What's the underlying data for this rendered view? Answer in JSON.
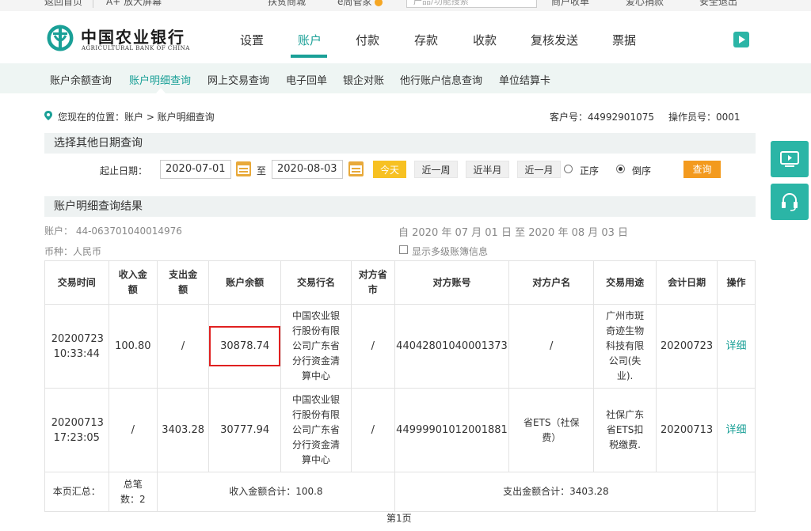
{
  "topbar": {
    "back_home": "返回首页",
    "enlarge": "A+ 放大屏幕",
    "mall": "扶贫商城",
    "steward": "e周管家",
    "search_placeholder": "产品/功能搜索",
    "pay_collect": "商户收单",
    "donate": "爱心捐款",
    "logout": "安全退出"
  },
  "brand": {
    "name_cn": "中国农业银行",
    "name_en": "AGRICULTURAL BANK OF CHINA"
  },
  "main_nav": [
    "设置",
    "账户",
    "付款",
    "存款",
    "收款",
    "复核发送",
    "票据"
  ],
  "main_nav_active": "账户",
  "sub_nav": [
    "账户余额查询",
    "账户明细查询",
    "网上交易查询",
    "电子回单",
    "银企对账",
    "他行账户信息查询",
    "单位结算卡"
  ],
  "sub_nav_active": "账户明细查询",
  "breadcrumb": {
    "text": "您现在的位置：账户 > 账户明细查询",
    "customer_no": "客户号：44992901075",
    "operator_no": "操作员号：0001"
  },
  "date_query": {
    "section_title": "选择其他日期查询",
    "start_label": "起止日期：",
    "start_date": "2020-07-01",
    "to_label": "至",
    "end_date": "2020-08-03",
    "today": "今天",
    "last_week": "近一周",
    "half_month": "近半月",
    "last_month": "近一月",
    "order_asc": "正序",
    "order_desc": "倒序",
    "order_selected": "倒序",
    "search": "查询"
  },
  "result": {
    "section_title": "账户明细查询结果",
    "account": "账户：  44-063701040014976",
    "currency": "币种：人民币",
    "date_range": "自 2020 年 07 月 01 日 至 2020 年 08 月 03 日",
    "multi_level": "显示多级账簿信息",
    "columns": [
      "交易时间",
      "收入金额",
      "支出金额",
      "账户余额",
      "交易行名",
      "对方省市",
      "对方账号",
      "对方户名",
      "交易用途",
      "会计日期",
      "操作"
    ],
    "rows": [
      {
        "time": "20200723 10:33:44",
        "income": "100.80",
        "expense": "/",
        "balance": "30878.74",
        "bank": "中国农业银行股份有限公司广东省分行资金清算中心",
        "province": "/",
        "account": "44042801040001373",
        "name": "/",
        "purpose": "广州市斑奇迹生物科技有限公司(失业).",
        "acct_date": "20200723",
        "action": "详细",
        "balance_highlighted": true
      },
      {
        "time": "20200713 17:23:05",
        "income": "/",
        "expense": "3403.28",
        "balance": "30777.94",
        "bank": "中国农业银行股份有限公司广东省分行资金清算中心",
        "province": "/",
        "account": "44999901012001881",
        "name": "省ETS（社保费）",
        "purpose": "社保广东省ETS扣税缴费.",
        "acct_date": "20200713",
        "action": "详细",
        "balance_highlighted": false
      }
    ],
    "summary": {
      "label": "本页汇总：",
      "count": "总笔数：2",
      "income_total": "收入金额合计：100.8",
      "expense_total": "支出金额合计：3403.28"
    },
    "page": "第1页"
  },
  "colors": {
    "brand_teal": "#1aa097",
    "today_btn": "#f7c122",
    "search_btn": "#f39a1e",
    "highlight_box": "#e02020"
  }
}
